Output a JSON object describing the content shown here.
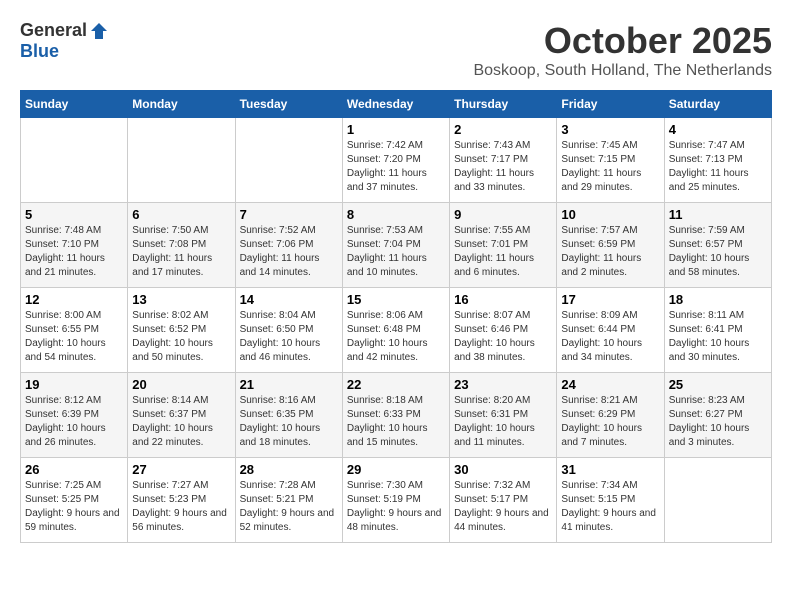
{
  "header": {
    "logo_general": "General",
    "logo_blue": "Blue",
    "month_title": "October 2025",
    "location": "Boskoop, South Holland, The Netherlands"
  },
  "days_of_week": [
    "Sunday",
    "Monday",
    "Tuesday",
    "Wednesday",
    "Thursday",
    "Friday",
    "Saturday"
  ],
  "weeks": [
    [
      {
        "day": "",
        "info": ""
      },
      {
        "day": "",
        "info": ""
      },
      {
        "day": "",
        "info": ""
      },
      {
        "day": "1",
        "info": "Sunrise: 7:42 AM\nSunset: 7:20 PM\nDaylight: 11 hours and 37 minutes."
      },
      {
        "day": "2",
        "info": "Sunrise: 7:43 AM\nSunset: 7:17 PM\nDaylight: 11 hours and 33 minutes."
      },
      {
        "day": "3",
        "info": "Sunrise: 7:45 AM\nSunset: 7:15 PM\nDaylight: 11 hours and 29 minutes."
      },
      {
        "day": "4",
        "info": "Sunrise: 7:47 AM\nSunset: 7:13 PM\nDaylight: 11 hours and 25 minutes."
      }
    ],
    [
      {
        "day": "5",
        "info": "Sunrise: 7:48 AM\nSunset: 7:10 PM\nDaylight: 11 hours and 21 minutes."
      },
      {
        "day": "6",
        "info": "Sunrise: 7:50 AM\nSunset: 7:08 PM\nDaylight: 11 hours and 17 minutes."
      },
      {
        "day": "7",
        "info": "Sunrise: 7:52 AM\nSunset: 7:06 PM\nDaylight: 11 hours and 14 minutes."
      },
      {
        "day": "8",
        "info": "Sunrise: 7:53 AM\nSunset: 7:04 PM\nDaylight: 11 hours and 10 minutes."
      },
      {
        "day": "9",
        "info": "Sunrise: 7:55 AM\nSunset: 7:01 PM\nDaylight: 11 hours and 6 minutes."
      },
      {
        "day": "10",
        "info": "Sunrise: 7:57 AM\nSunset: 6:59 PM\nDaylight: 11 hours and 2 minutes."
      },
      {
        "day": "11",
        "info": "Sunrise: 7:59 AM\nSunset: 6:57 PM\nDaylight: 10 hours and 58 minutes."
      }
    ],
    [
      {
        "day": "12",
        "info": "Sunrise: 8:00 AM\nSunset: 6:55 PM\nDaylight: 10 hours and 54 minutes."
      },
      {
        "day": "13",
        "info": "Sunrise: 8:02 AM\nSunset: 6:52 PM\nDaylight: 10 hours and 50 minutes."
      },
      {
        "day": "14",
        "info": "Sunrise: 8:04 AM\nSunset: 6:50 PM\nDaylight: 10 hours and 46 minutes."
      },
      {
        "day": "15",
        "info": "Sunrise: 8:06 AM\nSunset: 6:48 PM\nDaylight: 10 hours and 42 minutes."
      },
      {
        "day": "16",
        "info": "Sunrise: 8:07 AM\nSunset: 6:46 PM\nDaylight: 10 hours and 38 minutes."
      },
      {
        "day": "17",
        "info": "Sunrise: 8:09 AM\nSunset: 6:44 PM\nDaylight: 10 hours and 34 minutes."
      },
      {
        "day": "18",
        "info": "Sunrise: 8:11 AM\nSunset: 6:41 PM\nDaylight: 10 hours and 30 minutes."
      }
    ],
    [
      {
        "day": "19",
        "info": "Sunrise: 8:12 AM\nSunset: 6:39 PM\nDaylight: 10 hours and 26 minutes."
      },
      {
        "day": "20",
        "info": "Sunrise: 8:14 AM\nSunset: 6:37 PM\nDaylight: 10 hours and 22 minutes."
      },
      {
        "day": "21",
        "info": "Sunrise: 8:16 AM\nSunset: 6:35 PM\nDaylight: 10 hours and 18 minutes."
      },
      {
        "day": "22",
        "info": "Sunrise: 8:18 AM\nSunset: 6:33 PM\nDaylight: 10 hours and 15 minutes."
      },
      {
        "day": "23",
        "info": "Sunrise: 8:20 AM\nSunset: 6:31 PM\nDaylight: 10 hours and 11 minutes."
      },
      {
        "day": "24",
        "info": "Sunrise: 8:21 AM\nSunset: 6:29 PM\nDaylight: 10 hours and 7 minutes."
      },
      {
        "day": "25",
        "info": "Sunrise: 8:23 AM\nSunset: 6:27 PM\nDaylight: 10 hours and 3 minutes."
      }
    ],
    [
      {
        "day": "26",
        "info": "Sunrise: 7:25 AM\nSunset: 5:25 PM\nDaylight: 9 hours and 59 minutes."
      },
      {
        "day": "27",
        "info": "Sunrise: 7:27 AM\nSunset: 5:23 PM\nDaylight: 9 hours and 56 minutes."
      },
      {
        "day": "28",
        "info": "Sunrise: 7:28 AM\nSunset: 5:21 PM\nDaylight: 9 hours and 52 minutes."
      },
      {
        "day": "29",
        "info": "Sunrise: 7:30 AM\nSunset: 5:19 PM\nDaylight: 9 hours and 48 minutes."
      },
      {
        "day": "30",
        "info": "Sunrise: 7:32 AM\nSunset: 5:17 PM\nDaylight: 9 hours and 44 minutes."
      },
      {
        "day": "31",
        "info": "Sunrise: 7:34 AM\nSunset: 5:15 PM\nDaylight: 9 hours and 41 minutes."
      },
      {
        "day": "",
        "info": ""
      }
    ]
  ]
}
